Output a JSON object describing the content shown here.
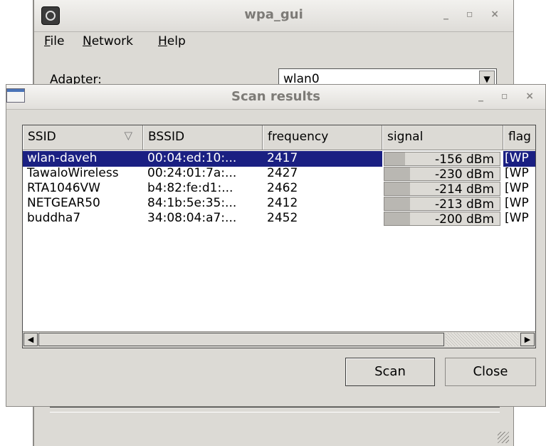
{
  "main_window": {
    "title": "wpa_gui",
    "wm_buttons": "_ ▫ ×",
    "menu": [
      "File",
      "Network",
      "Help"
    ],
    "adapter_label": "Adapter:",
    "adapter_value": "wlan0"
  },
  "scan_window": {
    "title": "Scan results",
    "wm_buttons": "_ ▫ ×",
    "columns": [
      "SSID",
      "BSSID",
      "frequency",
      "signal",
      "flag"
    ],
    "sort_indicator": "▽",
    "rows": [
      {
        "ssid": "wlan-daveh",
        "bssid": "00:04:ed:10:...",
        "frequency": "2417",
        "signal": "-156 dBm",
        "signal_level": 0.18,
        "flags": "[WP",
        "selected": true
      },
      {
        "ssid": "TawaloWireless",
        "bssid": "00:24:01:7a:...",
        "frequency": "2427",
        "signal": "-230 dBm",
        "signal_level": 0.22,
        "flags": "[WP",
        "selected": false
      },
      {
        "ssid": "RTA1046VW",
        "bssid": "b4:82:fe:d1:...",
        "frequency": "2462",
        "signal": "-214 dBm",
        "signal_level": 0.22,
        "flags": "[WP",
        "selected": false
      },
      {
        "ssid": "NETGEAR50",
        "bssid": "84:1b:5e:35:...",
        "frequency": "2412",
        "signal": "-213 dBm",
        "signal_level": 0.22,
        "flags": "[WP",
        "selected": false
      },
      {
        "ssid": "buddha7",
        "bssid": "34:08:04:a7:...",
        "frequency": "2452",
        "signal": "-200 dBm",
        "signal_level": 0.22,
        "flags": "[WP",
        "selected": false
      }
    ],
    "scan_button": "Scan",
    "close_button": "Close"
  },
  "icons": {
    "app_icon": "wpa-gui-app-icon",
    "window_icon": "window-icon",
    "sort_icon": "sort-descending-icon",
    "scroll_left": "scroll-left-arrow-icon",
    "scroll_right": "scroll-right-arrow-icon",
    "combo_arrow": "chevron-down-icon"
  },
  "colors": {
    "selection": "#1a1f82",
    "window_bg": "#dcdad5"
  }
}
